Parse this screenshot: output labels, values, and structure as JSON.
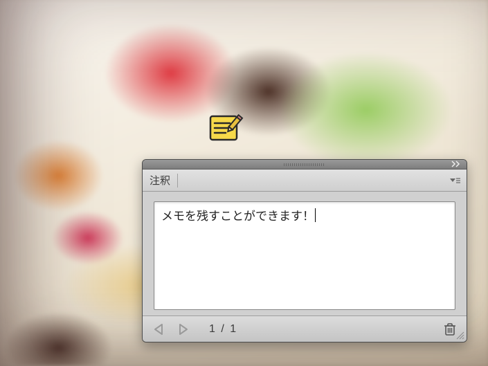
{
  "panel": {
    "title": "注釈",
    "note_text": "メモを残すことができます！",
    "page_indicator": "1 / 1"
  },
  "icons": {
    "note_edit": "note-edit-icon",
    "collapse": "collapse-icon",
    "panel_menu": "panel-menu-icon",
    "prev": "prev-arrow-icon",
    "next": "next-arrow-icon",
    "trash": "trash-icon",
    "resize": "resize-grip-icon"
  },
  "colors": {
    "note_yellow": "#f6d94a",
    "note_outline": "#2a2a2a",
    "panel_bg": "#d0d0d0"
  }
}
